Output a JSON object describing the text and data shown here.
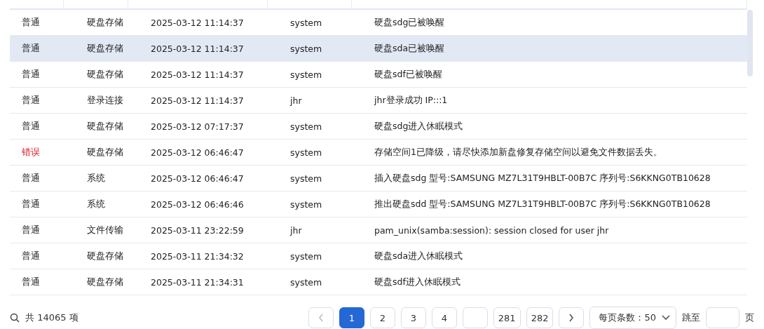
{
  "table": {
    "rows": [
      {
        "level": "普通",
        "kind": "normal",
        "category": "硬盘存储",
        "time": "2025-03-12 11:14:37",
        "user": "system",
        "message": "硬盘sdg已被唤醒",
        "selected": false
      },
      {
        "level": "普通",
        "kind": "normal",
        "category": "硬盘存储",
        "time": "2025-03-12 11:14:37",
        "user": "system",
        "message": "硬盘sda已被唤醒",
        "selected": true
      },
      {
        "level": "普通",
        "kind": "normal",
        "category": "硬盘存储",
        "time": "2025-03-12 11:14:37",
        "user": "system",
        "message": "硬盘sdf已被唤醒",
        "selected": false
      },
      {
        "level": "普通",
        "kind": "normal",
        "category": "登录连接",
        "time": "2025-03-12 11:14:37",
        "user": "jhr",
        "message": "jhr登录成功 IP:::1",
        "selected": false
      },
      {
        "level": "普通",
        "kind": "normal",
        "category": "硬盘存储",
        "time": "2025-03-12 07:17:37",
        "user": "system",
        "message": "硬盘sdg进入休眠模式",
        "selected": false
      },
      {
        "level": "错误",
        "kind": "error",
        "category": "硬盘存储",
        "time": "2025-03-12 06:46:47",
        "user": "system",
        "message": "存储空间1已降级，请尽快添加新盘修复存储空间以避免文件数据丢失。",
        "selected": false
      },
      {
        "level": "普通",
        "kind": "normal",
        "category": "系统",
        "time": "2025-03-12 06:46:47",
        "user": "system",
        "message": "插入硬盘sdg 型号:SAMSUNG MZ7L31T9HBLT-00B7C 序列号:S6KKNG0TB10628",
        "selected": false
      },
      {
        "level": "普通",
        "kind": "normal",
        "category": "系统",
        "time": "2025-03-12 06:46:46",
        "user": "system",
        "message": "推出硬盘sdd 型号:SAMSUNG MZ7L31T9HBLT-00B7C 序列号:S6KKNG0TB10628",
        "selected": false
      },
      {
        "level": "普通",
        "kind": "normal",
        "category": "文件传输",
        "time": "2025-03-11 23:22:59",
        "user": "jhr",
        "message": "pam_unix(samba:session): session closed for user jhr",
        "selected": false
      },
      {
        "level": "普通",
        "kind": "normal",
        "category": "硬盘存储",
        "time": "2025-03-11 21:34:32",
        "user": "system",
        "message": "硬盘sda进入休眠模式",
        "selected": false
      },
      {
        "level": "普通",
        "kind": "normal",
        "category": "硬盘存储",
        "time": "2025-03-11 21:34:31",
        "user": "system",
        "message": "硬盘sdf进入休眠模式",
        "selected": false
      }
    ]
  },
  "pagination": {
    "total": "共 14065 项",
    "pages": [
      {
        "label": "1",
        "kind": "page",
        "selected": true
      },
      {
        "label": "2",
        "kind": "page",
        "selected": false
      },
      {
        "label": "3",
        "kind": "page",
        "selected": false
      },
      {
        "label": "4",
        "kind": "page",
        "selected": false
      },
      {
        "kind": "gap",
        "selected": false
      },
      {
        "label": "281",
        "kind": "page",
        "selected": false
      },
      {
        "label": "282",
        "kind": "page",
        "selected": false
      }
    ],
    "page_size": "每页条数：50",
    "jump_label": "跳至",
    "jump_suffix": "页"
  }
}
